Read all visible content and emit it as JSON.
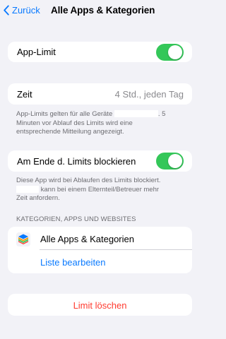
{
  "nav": {
    "back_label": "Zurück",
    "title": "Alle Apps & Kategorien"
  },
  "app_limit": {
    "label": "App-Limit",
    "enabled": true
  },
  "time": {
    "label": "Zeit",
    "value": "4 Std., jeden Tag"
  },
  "footnote1": {
    "line1_before": "App-Limits gelten für alle Geräte ",
    "line1_after": ". 5",
    "line2": "Minuten vor Ablauf des Limits wird eine",
    "line3": "entsprechende Mitteilung angezeigt."
  },
  "block_at_end": {
    "label": "Am Ende d. Limits blockieren",
    "enabled": true
  },
  "footnote2": {
    "line1": "Diese App wird bei Ablaufen des Limits blockiert.",
    "line2_after": " kann bei einem Elternteil/Betreuer mehr",
    "line3": "Zeit anfordern."
  },
  "section": {
    "header": "KATEGORIEN, APPS UND WEBSITES"
  },
  "category": {
    "label": "Alle Apps & Kategorien",
    "icon": "stack-layers-icon"
  },
  "edit_list": {
    "label": "Liste bearbeiten"
  },
  "delete": {
    "label": "Limit löschen"
  },
  "colors": {
    "accent": "#0a7aff",
    "toggle_on": "#34c759",
    "danger": "#ff3b30",
    "background": "#f2f2f7"
  }
}
